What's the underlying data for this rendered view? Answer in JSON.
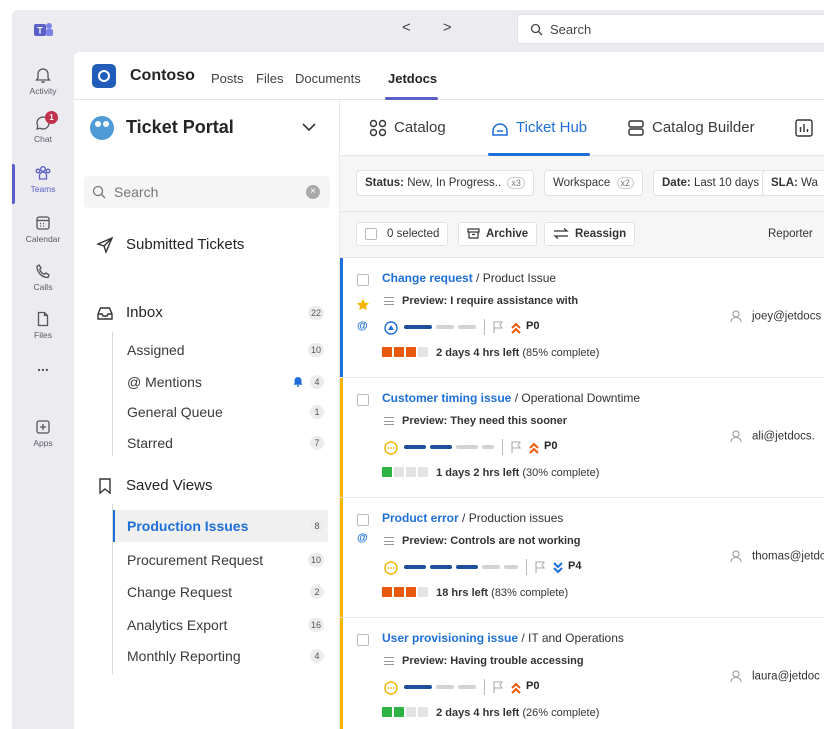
{
  "topbar": {
    "search_placeholder": "Search",
    "nav": "< >"
  },
  "rail": {
    "items": [
      {
        "label": "Activity"
      },
      {
        "label": "Chat",
        "badge": "1"
      },
      {
        "label": "Teams"
      },
      {
        "label": "Calendar"
      },
      {
        "label": "Calls"
      },
      {
        "label": "Files"
      },
      {
        "label": "..."
      },
      {
        "label": "Apps"
      }
    ]
  },
  "channel": {
    "name": "Contoso",
    "tabs": [
      "Posts",
      "Files",
      "Documents",
      "Jetdocs"
    ]
  },
  "portal": {
    "title": "Ticket Portal",
    "search_placeholder": "Search",
    "submitted": "Submitted Tickets",
    "inbox": {
      "label": "Inbox",
      "count": "22"
    },
    "inbox_items": [
      {
        "label": "Assigned",
        "count": "10"
      },
      {
        "label": "@ Mentions",
        "count": "4"
      },
      {
        "label": "General Queue",
        "count": "1"
      },
      {
        "label": "Starred",
        "count": "7"
      }
    ],
    "saved_views": {
      "label": "Saved Views"
    },
    "views": [
      {
        "label": "Production Issues",
        "count": "8"
      },
      {
        "label": "Procurement Request",
        "count": "10"
      },
      {
        "label": "Change Request",
        "count": "2"
      },
      {
        "label": "Analytics Export",
        "count": "16"
      },
      {
        "label": "Monthly Reporting",
        "count": "4"
      }
    ]
  },
  "apptabs": [
    "Catalog",
    "Ticket Hub",
    "Catalog Builder"
  ],
  "filters": [
    {
      "key": "Status:",
      "value": "New, In Progress..",
      "x": "x3"
    },
    {
      "key": "",
      "value": "Workspace",
      "x": "x2"
    },
    {
      "key": "Date:",
      "value": "Last 10 days",
      "x": ""
    },
    {
      "key": "SLA:",
      "value": "Wa",
      "x": ""
    }
  ],
  "toolbar": {
    "selected": "0 selected",
    "archive": "Archive",
    "reassign": "Reassign",
    "reporter_col": "Reporter"
  },
  "tickets": [
    {
      "title": "Change request",
      "category": " / Product Issue",
      "preview": "Preview: I require assistance with",
      "priority": "P0",
      "sla": "2 days 4 hrs left",
      "pct": " (85% complete)",
      "reporter": "joey@jetdocs",
      "accent": "#1e6fd9"
    },
    {
      "title": "Customer timing issue",
      "category": " / Operational Downtime",
      "preview": "Preview: They need this sooner",
      "priority": "P0",
      "sla": "1 days 2 hrs left",
      "pct": " (30% complete)",
      "reporter": "ali@jetdocs.",
      "accent": "#f4b400"
    },
    {
      "title": "Product error",
      "category": " / Production issues",
      "preview": "Preview: Controls are not working",
      "priority": "P4",
      "sla": "18 hrs left",
      "pct": " (83% complete)",
      "reporter": "thomas@jetdo",
      "accent": "#f4b400"
    },
    {
      "title": "User provisioning issue",
      "category": " / IT and Operations",
      "preview": "Preview: Having trouble accessing",
      "priority": "P0",
      "sla": "2 days 4 hrs left",
      "pct": " (26% complete)",
      "reporter": "laura@jetdoc",
      "accent": "#f4b400"
    }
  ]
}
